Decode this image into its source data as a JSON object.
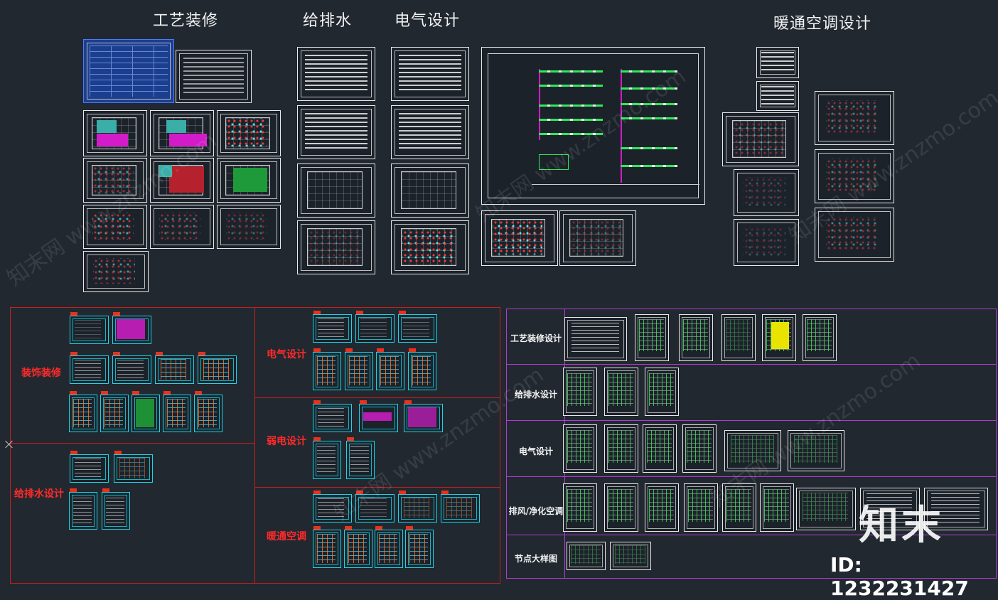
{
  "top_headings": {
    "craft_decoration": "工艺装修",
    "water_supply_drainage": "给排水",
    "electrical_design": "电气设计",
    "hvac_design": "暖通空调设计"
  },
  "left_panel": {
    "labels": {
      "decoration": "装饰装修",
      "water": "给排水设计",
      "electrical": "电气设计",
      "weak_current": "弱电设计",
      "hvac": "暖通空调"
    }
  },
  "right_panel": {
    "rows": [
      {
        "label": "工艺装修设计"
      },
      {
        "label": "给排水设计"
      },
      {
        "label": "电气设计"
      },
      {
        "label": "排风/净化空调"
      },
      {
        "label": "节点大样图"
      }
    ]
  },
  "branding": {
    "logo_text": "知末",
    "id_text": "ID: 1232231427",
    "watermark_text": "知末网 www.znzmo.com"
  },
  "colors": {
    "background": "#212830",
    "left_panel_border": "#c81e1e",
    "right_panel_border": "#b13bd4",
    "sheet_cyan": "#19d6e8",
    "label_red": "#ff2a2a"
  }
}
